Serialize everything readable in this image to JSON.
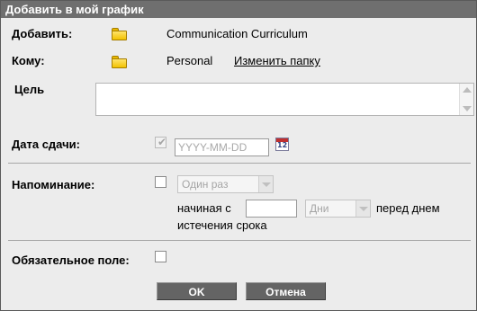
{
  "dialog": {
    "title": "Добавить в мой график"
  },
  "add": {
    "label": "Добавить:",
    "icon": "folder-icon",
    "value": "Communication Curriculum"
  },
  "to": {
    "label": "Кому:",
    "icon": "folder-icon",
    "value": "Personal",
    "change_link": "Изменить папку"
  },
  "goal": {
    "label": "Цель",
    "value": ""
  },
  "due_date": {
    "label": "Дата сдачи:",
    "checked": true,
    "placeholder": "YYYY-MM-DD",
    "calendar_icon": "calendar-icon",
    "calendar_day": "12"
  },
  "reminder": {
    "label": "Напоминание:",
    "checked": false,
    "frequency_selected": "Один раз",
    "starting_label": "начиная с",
    "offset_value": "",
    "unit_selected": "Дни",
    "before_text_line1": "перед днем",
    "before_text_line2": "истечения срока"
  },
  "required": {
    "label": "Обязательное поле:",
    "checked": false
  },
  "buttons": {
    "ok": "OK",
    "cancel": "Отмена"
  },
  "colors": {
    "titlebar": "#6f6f6f",
    "dialog_bg": "#ececec",
    "button_bg": "#646464"
  }
}
